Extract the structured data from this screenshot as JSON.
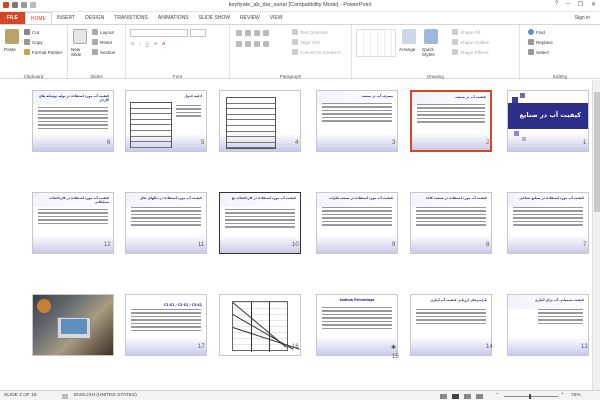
{
  "window": {
    "title": "keyfiyate_ab_dar_sanat [Compatibility Mode] - PowerPoint",
    "help": "?",
    "minimize": "–",
    "restore": "❐",
    "close": "✕"
  },
  "tabs": [
    {
      "label": "FILE"
    },
    {
      "label": "HOME"
    },
    {
      "label": "INSERT"
    },
    {
      "label": "DESIGN"
    },
    {
      "label": "TRANSITIONS"
    },
    {
      "label": "ANIMATIONS"
    },
    {
      "label": "SLIDE SHOW"
    },
    {
      "label": "REVIEW"
    },
    {
      "label": "VIEW"
    }
  ],
  "user": {
    "label": "Sign in"
  },
  "ribbon": {
    "clipboard": {
      "label": "Clipboard",
      "paste": "Paste",
      "cut": "Cut",
      "copy": "Copy",
      "format_painter": "Format Painter"
    },
    "slides": {
      "label": "Slides",
      "new_slide": "New Slide",
      "layout": "Layout",
      "reset": "Reset",
      "section": "Section"
    },
    "font": {
      "label": "Font",
      "font_name": "",
      "font_size": "",
      "bold": "B",
      "italic": "I",
      "underline": "U",
      "strike": "S",
      "aa": "A"
    },
    "paragraph": {
      "label": "Paragraph",
      "text_direction": "Text Direction",
      "align_text": "Align Text",
      "convert": "Convert to SmartArt"
    },
    "drawing": {
      "label": "Drawing",
      "arrange": "Arrange",
      "quick_styles": "Quick Styles",
      "shape_fill": "Shape Fill",
      "shape_outline": "Shape Outline",
      "shape_effects": "Shape Effects"
    },
    "editing": {
      "label": "Editing",
      "find": "Find",
      "replace": "Replace",
      "select": "Select"
    }
  },
  "slides": [
    {
      "num": "1",
      "title": "کیفیت آب در صنایع"
    },
    {
      "num": "2",
      "title": "کیفیت آب در صنعت"
    },
    {
      "num": "3",
      "title": "مصرف آب در صنعت"
    },
    {
      "num": "4",
      "title": ""
    },
    {
      "num": "5",
      "title": "ادامه جدول"
    },
    {
      "num": "6",
      "title": "کیفیت آب مورد استفاده در تولید نوشابه های گازدار"
    },
    {
      "num": "7",
      "title": "کیفیت آب مورد استفاده در صنایع نساجی"
    },
    {
      "num": "8",
      "title": "کیفیت آب مورد استفاده در صنعت کاغذ"
    },
    {
      "num": "9",
      "title": "کیفیت آب مورد استفاده در صنعت فلزات"
    },
    {
      "num": "10",
      "title": "کیفیت آب مورد استفاده در کارخانجات یخ"
    },
    {
      "num": "11",
      "title": "کیفیت آب مورد استفاده در دیگهای بخار"
    },
    {
      "num": "12",
      "title": "کیفیت آب مورد استفاده در کارخانجات سیلیکاتی"
    },
    {
      "num": "13",
      "title": "کیفیت شیمیایی آب برای آبیاری"
    },
    {
      "num": "14",
      "title": "پارامترهای ارزیابی کیفیت آب آبیاری"
    },
    {
      "num": "15",
      "title": "Sodium Percentage"
    },
    {
      "num": "16",
      "title": ""
    },
    {
      "num": "17",
      "title": "C1-S1 / C2-S1 / C3-S1"
    },
    {
      "num": "18",
      "title": ""
    }
  ],
  "status": {
    "slide_info": "SLIDE 2 OF 18",
    "language": "ENGLISH (UNITED STATES)",
    "zoom": "75%"
  }
}
